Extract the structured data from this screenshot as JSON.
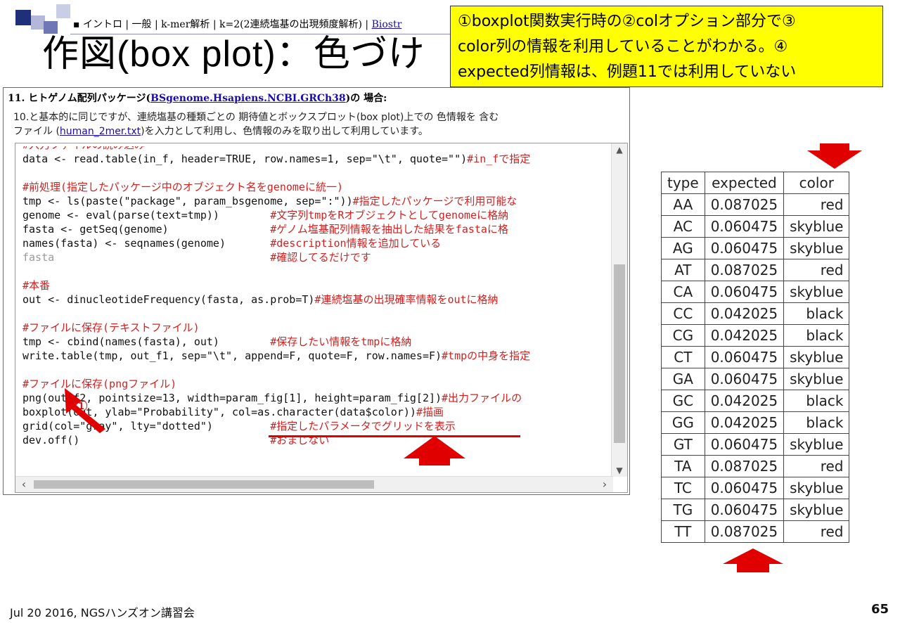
{
  "nav": {
    "text": "▪ イントロ | 一般 | k-mer解析 | k=2(2連続塩基の出現頻度解析) | ",
    "link": "Biostr"
  },
  "slide_title": "作図(box plot)：色づけ",
  "callout": {
    "line1": "①boxplot関数実行時の②colオプション部分で③",
    "line2": "color列の情報を利用していることがわかる。④",
    "line3": "expected列情報は、例題11では利用していない"
  },
  "section": {
    "prefix": "11. ヒトゲノム配列パッケージ(",
    "link": "BSgenome.Hsapiens.NCBI.GRCh38",
    "suffix": ")の 場合:"
  },
  "description": {
    "line1": "10.と基本的に同じですが、連続塩基の種類ごとの 期待値とボックスプロット(box plot)上での 色情報を 含む",
    "line2_prefix": "ファイル (",
    "file_link": "human_2mer.txt",
    "line2_suffix": ")を入力として利用し、色情報のみを取り出して利用しています。"
  },
  "code": {
    "l0": "#入力ファイルの読み込み",
    "l1": "data <- read.table(in_f, header=TRUE, row.names=1, sep=\"\\t\", quote=\"\")",
    "l1c": "#in_fで指定",
    "l3": "#前処理(指定したパッケージ中のオブジェクト名をgenomeに統一)",
    "l4": "tmp <- ls(paste(\"package\", param_bsgenome, sep=\":\"))",
    "l4c": "#指定したパッケージで利用可能な",
    "l5": "genome <- eval(parse(text=tmp))        ",
    "l5c": "#文字列tmpをRオブジェクトとしてgenomeに格納",
    "l6": "fasta <- getSeq(genome)                ",
    "l6c": "#ゲノム塩基配列情報を抽出した結果をfastaに格",
    "l7": "names(fasta) <- seqnames(genome)       ",
    "l7c": "#description情報を追加している",
    "l8": "fasta                                  ",
    "l8c": "#確認してるだけです",
    "l10": "#本番",
    "l11": "out <- dinucleotideFrequency(fasta, as.prob=T)",
    "l11c": "#連続塩基の出現確率情報をoutに格納",
    "l13": "#ファイルに保存(テキストファイル)",
    "l14": "tmp <- cbind(names(fasta), out)        ",
    "l14c": "#保存したい情報をtmpに格納",
    "l15": "write.table(tmp, out_f1, sep=\"\\t\", append=F, quote=F, row.names=F)",
    "l15c": "#tmpの中身を指定",
    "l17": "#ファイルに保存(pngファイル)",
    "l18": "png(out_f2, pointsize=13, width=param_fig[1], height=param_fig[2])",
    "l18c": "#出力ファイルの",
    "l19": "boxplot(out, ylab=\"Probability\", col=as.character(data$color))",
    "l19c": "#描画",
    "l20": "grid(col=\"gray\", lty=\"dotted\")         ",
    "l20c": "#指定したパラメータでグリッドを表示",
    "l21": "dev.off()                              ",
    "l21c": "#おまじない"
  },
  "table": {
    "headers": [
      "type",
      "expected",
      "color"
    ],
    "rows": [
      [
        "AA",
        "0.087025",
        "red"
      ],
      [
        "AC",
        "0.060475",
        "skyblue"
      ],
      [
        "AG",
        "0.060475",
        "skyblue"
      ],
      [
        "AT",
        "0.087025",
        "red"
      ],
      [
        "CA",
        "0.060475",
        "skyblue"
      ],
      [
        "CC",
        "0.042025",
        "black"
      ],
      [
        "CG",
        "0.042025",
        "black"
      ],
      [
        "CT",
        "0.060475",
        "skyblue"
      ],
      [
        "GA",
        "0.060475",
        "skyblue"
      ],
      [
        "GC",
        "0.042025",
        "black"
      ],
      [
        "GG",
        "0.042025",
        "black"
      ],
      [
        "GT",
        "0.060475",
        "skyblue"
      ],
      [
        "TA",
        "0.087025",
        "red"
      ],
      [
        "TC",
        "0.060475",
        "skyblue"
      ],
      [
        "TG",
        "0.060475",
        "skyblue"
      ],
      [
        "TT",
        "0.087025",
        "red"
      ]
    ]
  },
  "markers": {
    "m1": "①",
    "m2": "②",
    "m3": "③",
    "m4": "④"
  },
  "footer": {
    "date": "Jul 20 2016, NGSハンズオン講習会",
    "page": "65"
  },
  "colors": {
    "callout_bg": "#ffff00",
    "accent_red": "#e00000",
    "deco_blue": "#1f2f7a",
    "deco_lavender": "#b3b8da"
  }
}
